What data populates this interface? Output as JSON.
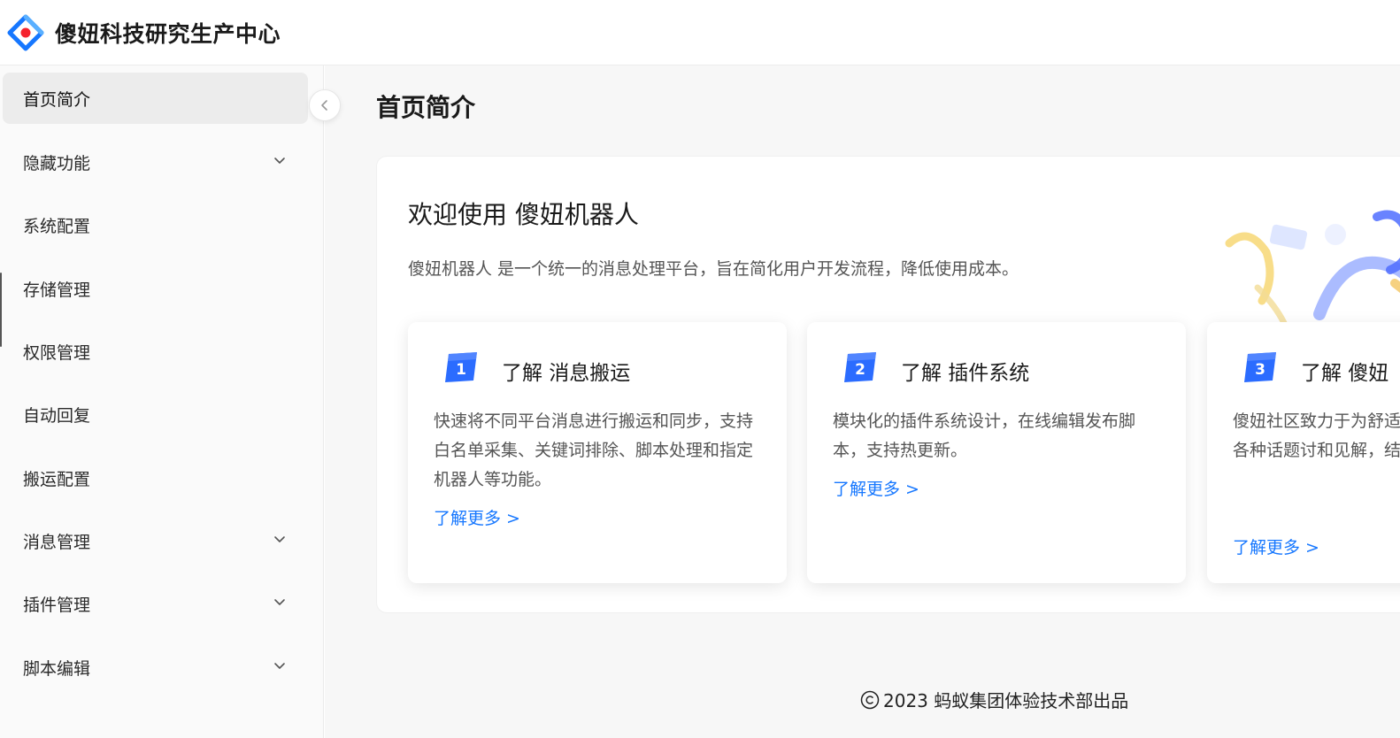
{
  "header": {
    "brand": "傻妞科技研究生产中心",
    "logo_icon": "diamond-logo-icon",
    "accent_color": "#1677ff",
    "logo_dot_color": "#f5222d"
  },
  "sidebar": {
    "items": [
      {
        "label": "首页简介",
        "active": true,
        "expandable": false
      },
      {
        "label": "隐藏功能",
        "active": false,
        "expandable": true
      },
      {
        "label": "系统配置",
        "active": false,
        "expandable": false
      },
      {
        "label": "存储管理",
        "active": false,
        "expandable": false
      },
      {
        "label": "权限管理",
        "active": false,
        "expandable": false
      },
      {
        "label": "自动回复",
        "active": false,
        "expandable": false
      },
      {
        "label": "搬运配置",
        "active": false,
        "expandable": false
      },
      {
        "label": "消息管理",
        "active": false,
        "expandable": true
      },
      {
        "label": "插件管理",
        "active": false,
        "expandable": true
      },
      {
        "label": "脚本编辑",
        "active": false,
        "expandable": true
      }
    ]
  },
  "main": {
    "page_title": "首页简介",
    "welcome": {
      "title": "欢迎使用 傻妞机器人",
      "description": "傻妞机器人 是一个统一的消息处理平台，旨在简化用户开发流程，降低使用成本。"
    },
    "features": [
      {
        "number": "1",
        "title": "了解 消息搬运",
        "description": "快速将不同平台消息进行搬运和同步，支持白名单采集、关键词排除、脚本处理和指定机器人等功能。",
        "link": "了解更多 >"
      },
      {
        "number": "2",
        "title": "了解 插件系统",
        "description": "模块化的插件系统设计，在线编辑发布脚本，支持热更新。",
        "link": "了解更多 >"
      },
      {
        "number": "3",
        "title": "了解 傻妞",
        "description": "傻妞社区致力于为舒适的交流空间。以参与各种话题讨和见解，结识志同道",
        "link": "了解更多 >"
      }
    ]
  },
  "footer": {
    "text": "2023 蚂蚁集团体验技术部出品",
    "icon": "copyright-icon"
  }
}
